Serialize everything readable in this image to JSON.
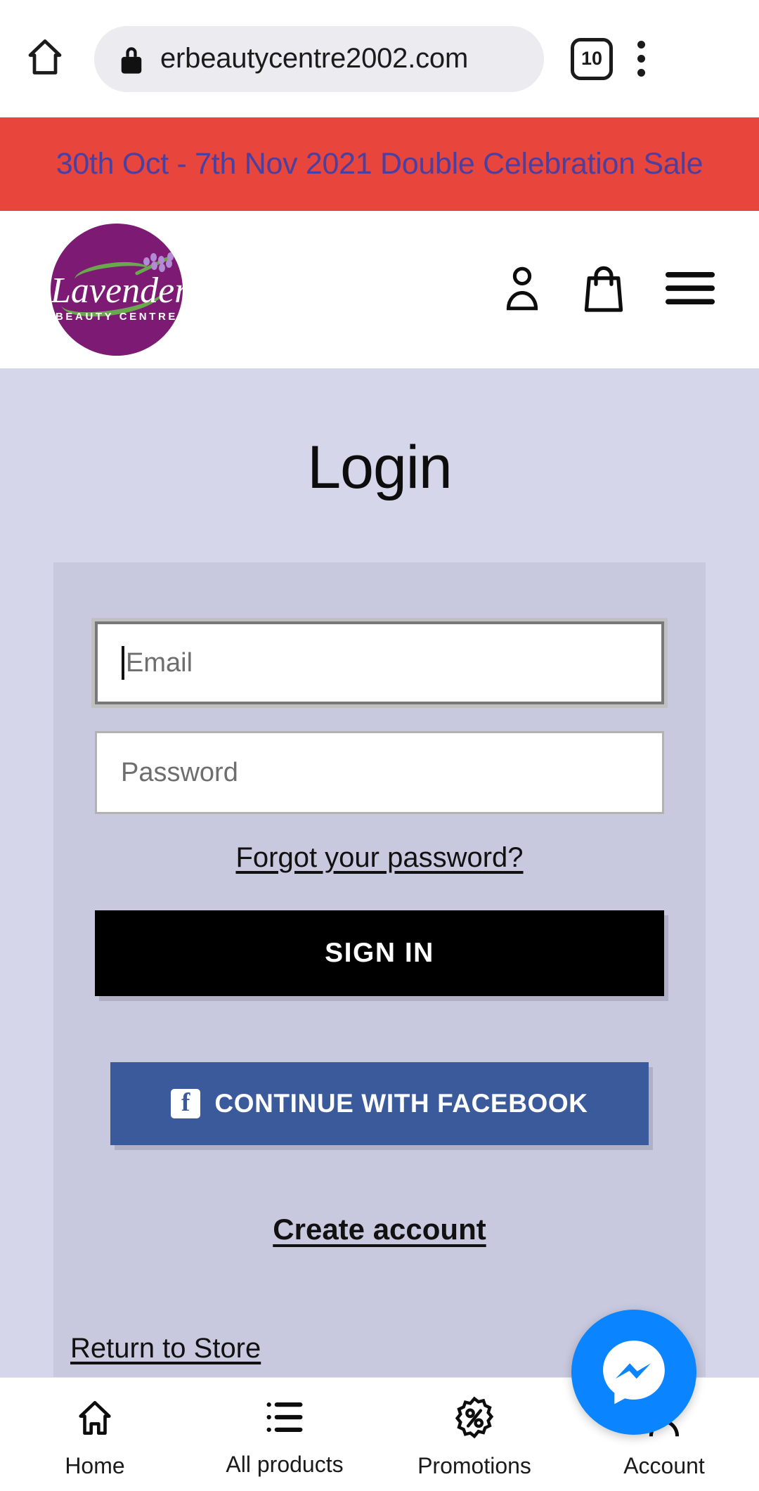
{
  "browser": {
    "home_icon": "home-icon",
    "lock_icon": "lock-icon",
    "url": "erbeautycentre2002.com",
    "tab_count": "10",
    "menu_icon": "kebab-menu-icon"
  },
  "promo": {
    "text": "30th Oct - 7th Nov 2021 Double Celebration Sale",
    "background": "#e8453c",
    "text_color": "#4b3fa0"
  },
  "site_header": {
    "logo": {
      "brand": "Lavender",
      "tagline": "BEAUTY CENTRE",
      "circle_color": "#7d1a74"
    },
    "icons": [
      {
        "name": "account-icon",
        "label": "Account"
      },
      {
        "name": "shopping-bag-icon",
        "label": "Cart"
      },
      {
        "name": "hamburger-menu-icon",
        "label": "Menu"
      }
    ]
  },
  "login": {
    "title": "Login",
    "email": {
      "placeholder": "Email",
      "value": "",
      "focused": true
    },
    "password": {
      "placeholder": "Password",
      "value": "",
      "focused": false
    },
    "forgot_label": "Forgot your password?",
    "signin_label": "SIGN IN",
    "facebook_label": "CONTINUE WITH FACEBOOK",
    "facebook_glyph": "f",
    "facebook_color": "#3a5a9b",
    "create_label": "Create account",
    "return_label": "Return to Store",
    "page_bg": "#d5d6e9",
    "panel_bg": "#c8c9de"
  },
  "bottom_nav": {
    "items": [
      {
        "icon": "home-icon",
        "label": "Home"
      },
      {
        "icon": "list-icon",
        "label": "All products"
      },
      {
        "icon": "percent-badge-icon",
        "label": "Promotions"
      },
      {
        "icon": "person-icon",
        "label": "Account"
      }
    ]
  },
  "messenger": {
    "icon": "messenger-icon",
    "color": "#0a84ff"
  }
}
